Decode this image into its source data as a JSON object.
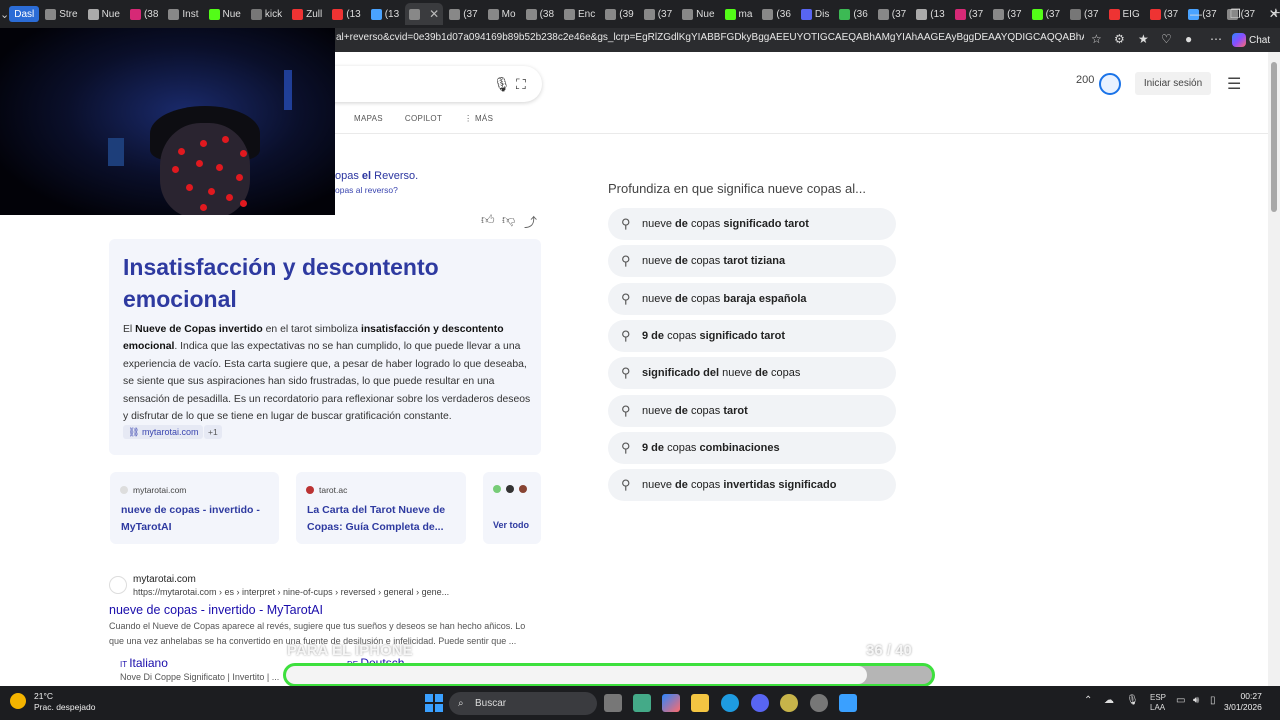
{
  "browser": {
    "tabs": [
      "Dasl",
      "Stre",
      "Nue",
      "(38",
      "Inst",
      "Nue",
      "kick",
      "Zull",
      "(13",
      "(13",
      "",
      "(37",
      "Mo",
      "(38",
      "Enc",
      "(39",
      "(37",
      "Nue",
      "ma",
      "(36",
      "Dis",
      "(36",
      "(37",
      "(13",
      "(37",
      "(37",
      "(37",
      "(37",
      "EIG",
      "(37",
      "(37",
      "(37"
    ],
    "url": "al+reverso&cvid=0e39b1d07a094169b89b52b238c2e46e&gs_lcrp=EgRlZGdlKgYIABBFGDkyBggAEEUYOTIGCAEQABhAMgYIAhAAGEAyBggDEAAYQDIGCAQQABhAMgYIBRAAGEAyB...",
    "copilot_label": "Chat"
  },
  "header": {
    "rewards_points": "200",
    "signin_label": "Iniciar sesión",
    "nav": [
      "MAPAS",
      "COPILOT",
      "MÁS"
    ]
  },
  "didyoumean": {
    "line1_pre": "opas ",
    "line1_bold": "el",
    "line1_post": " Reverso.",
    "line2": "opas al reverso?"
  },
  "answer": {
    "title": "Insatisfacción y descontento emocional",
    "p1": "El ",
    "b1": "Nueve de Copas invertido",
    "p2": " en el tarot simboliza ",
    "b2": "insatisfacción y descontento emocional",
    "p3": ". Indica que las expectativas no se han cumplido, lo que puede llevar a una experiencia de vacío. Esta carta sugiere que, a pesar de haber logrado lo que deseaba, se siente que sus aspiraciones han sido frustradas, lo que puede resultar en una sensación de pesadilla. Es un recordatorio para reflexionar sobre los verdaderos deseos y disfrutar de lo que se tiene en lugar de buscar gratificación constante.",
    "cite_label": "mytarotai.com",
    "cite_more": "+1"
  },
  "sources": [
    {
      "site": "mytarotai.com",
      "title": "nueve de copas - invertido - MyTarotAI"
    },
    {
      "site": "tarot.ac",
      "title": "La Carta del Tarot Nueve de Copas: Guía Completa de..."
    }
  ],
  "see_all": "Ver todo",
  "organic": {
    "site": "mytarotai.com",
    "path": "https://mytarotai.com › es › interpret › nine-of-cups › reversed › general › gene...",
    "title": "nueve de copas - invertido - MyTarotAI",
    "snippet": "Cuando el Nueve de Copas aparece al revés, sugiere que tus sueños y deseos se han hecho añicos. Lo que una vez anhelabas se ha convertido en una fuente de desilusión e infelicidad. Puede sentir que ...",
    "sub1_title": "Italiano",
    "sub1_snip": "Nove Di Coppe Significato | Invertito | ...",
    "sub2_title": "Deutsch"
  },
  "related": {
    "heading": "Profundiza en que significa nueve copas al...",
    "items": [
      [
        [
          "nueve ",
          false
        ],
        [
          "de ",
          true
        ],
        [
          "copas ",
          false
        ],
        [
          "significado tarot",
          true
        ]
      ],
      [
        [
          "nueve ",
          false
        ],
        [
          "de ",
          true
        ],
        [
          "copas ",
          false
        ],
        [
          "tarot tiziana",
          true
        ]
      ],
      [
        [
          "nueve ",
          false
        ],
        [
          "de ",
          true
        ],
        [
          "copas ",
          false
        ],
        [
          "baraja española",
          true
        ]
      ],
      [
        [
          "9 de ",
          true
        ],
        [
          "copas ",
          false
        ],
        [
          "significado tarot",
          true
        ]
      ],
      [
        [
          "significado del ",
          true
        ],
        [
          "nueve ",
          false
        ],
        [
          "de ",
          true
        ],
        [
          "copas",
          false
        ]
      ],
      [
        [
          "nueve ",
          false
        ],
        [
          "de ",
          true
        ],
        [
          "copas ",
          false
        ],
        [
          "tarot",
          true
        ]
      ],
      [
        [
          "9 de ",
          true
        ],
        [
          "copas ",
          false
        ],
        [
          "combinaciones",
          true
        ]
      ],
      [
        [
          "nueve ",
          false
        ],
        [
          "de ",
          true
        ],
        [
          "copas ",
          false
        ],
        [
          "invertidas significado",
          true
        ]
      ]
    ]
  },
  "overlay": {
    "text": "PARA EL IPHONE",
    "count": "36 / 40",
    "progress": 0.9
  },
  "taskbar": {
    "temp": "21°C",
    "weather": "Prac. despejado",
    "search_label": "Buscar",
    "lang1": "ESP",
    "lang2": "LAA",
    "time": "00:27",
    "date": "3/01/2026"
  },
  "colors": {
    "accent": "#2e3aa0",
    "link": "#1a0dab",
    "progress_border": "#3de03d"
  }
}
